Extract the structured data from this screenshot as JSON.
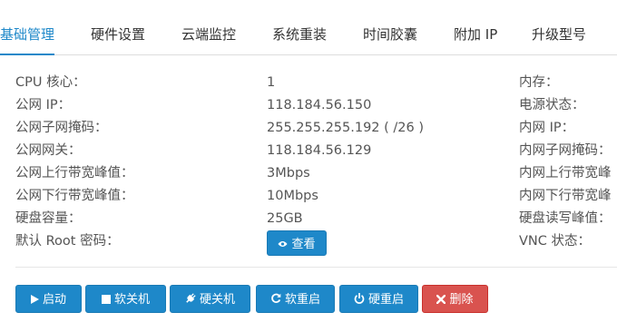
{
  "tabs": [
    {
      "label": "基础管理"
    },
    {
      "label": "硬件设置"
    },
    {
      "label": "云端监控"
    },
    {
      "label": "系统重装"
    },
    {
      "label": "时间胶囊"
    },
    {
      "label": "附加 IP"
    },
    {
      "label": "升级型号"
    }
  ],
  "info": {
    "left_labels": [
      "CPU 核心：",
      "公网 IP：",
      "公网子网掩码：",
      "公网网关：",
      "公网上行带宽峰值：",
      "公网下行带宽峰值：",
      "硬盘容量：",
      "默认 Root 密码："
    ],
    "values": [
      "1",
      "118.184.56.150",
      "255.255.255.192 ( /26 )",
      "118.184.56.129",
      "3Mbps",
      "10Mbps",
      "25GB"
    ],
    "view_button": "查看",
    "right_labels": [
      "内存：",
      "电源状态：",
      "内网 IP：",
      "内网子网掩码：",
      "内网上行带宽峰",
      "内网下行带宽峰",
      "硬盘读写峰值：",
      "VNC 状态："
    ]
  },
  "actions": {
    "start": "启动",
    "soft_shutdown": "软关机",
    "hard_shutdown": "硬关机",
    "soft_reboot": "软重启",
    "hard_reboot": "硬重启",
    "delete": "删除"
  },
  "icons": {
    "start": "play-icon",
    "soft_shutdown": "stop-square-icon",
    "hard_shutdown": "plug-icon",
    "soft_reboot": "refresh-icon",
    "hard_reboot": "power-icon",
    "delete": "close-x-icon",
    "view": "eye-icon"
  },
  "colors": {
    "primary": "#1e88c9",
    "danger": "#d9534f",
    "text": "#555555"
  }
}
